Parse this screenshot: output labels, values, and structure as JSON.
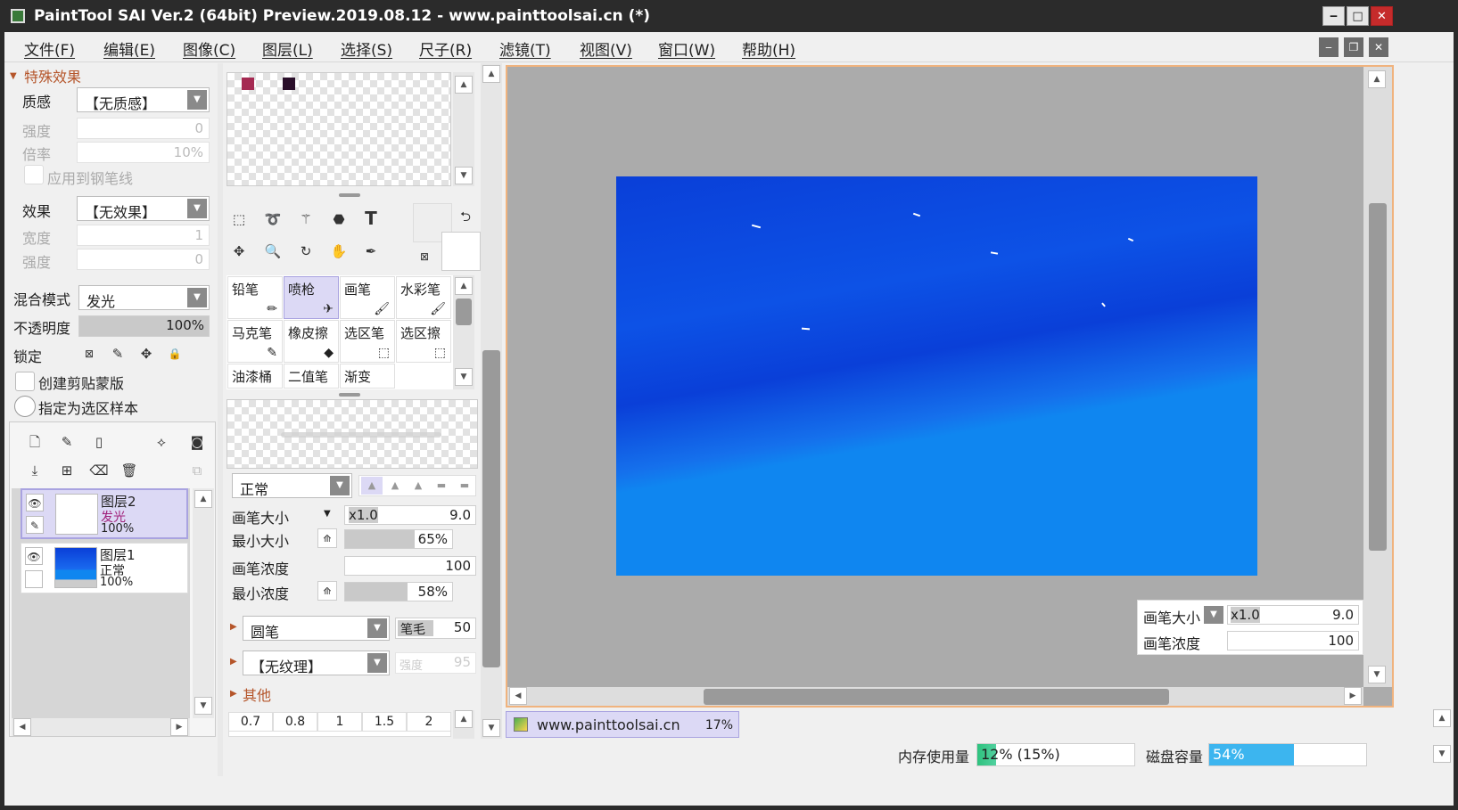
{
  "window": {
    "title": "PaintTool SAI Ver.2 (64bit) Preview.2019.08.12 - www.painttoolsai.cn (*)"
  },
  "menu": [
    "文件(F)",
    "编辑(E)",
    "图像(C)",
    "图层(L)",
    "选择(S)",
    "尺子(R)",
    "滤镜(T)",
    "视图(V)",
    "窗口(W)",
    "帮助(H)"
  ],
  "effects": {
    "header": "特殊效果",
    "texture_label": "质感",
    "texture_value": "【无质感】",
    "strength_label": "强度",
    "strength_value": "0",
    "scale_label": "倍率",
    "scale_value": "10%",
    "apply_pen_label": "应用到钢笔线",
    "effect_label": "效果",
    "effect_value": "【无效果】",
    "width_label": "宽度",
    "width_value": "1",
    "strength2_label": "强度",
    "strength2_value": "0"
  },
  "layer_props": {
    "blend_label": "混合模式",
    "blend_value": "发光",
    "opacity_label": "不透明度",
    "opacity_value": "100%",
    "opacity_fraction": 1.0,
    "lock_label": "锁定",
    "clip_label": "创建剪贴蒙版",
    "sample_label": "指定为选区样本"
  },
  "layers": [
    {
      "name": "图层2",
      "mode": "发光",
      "opacity": "100%"
    },
    {
      "name": "图层1",
      "mode": "正常",
      "opacity": "100%"
    }
  ],
  "tools_grid": [
    [
      "铅笔",
      "喷枪",
      "画笔",
      "水彩笔"
    ],
    [
      "马克笔",
      "橡皮擦",
      "选区笔",
      "选区擦"
    ],
    [
      "油漆桶",
      "二值笔",
      "渐变",
      ""
    ]
  ],
  "brush": {
    "mode_value": "正常",
    "size_label": "画笔大小",
    "size_mult": "x1.0",
    "size_value": "9.0",
    "min_size_label": "最小大小",
    "min_size_value": "65%",
    "min_size_fraction": 0.65,
    "density_label": "画笔浓度",
    "density_value": "100",
    "min_density_label": "最小浓度",
    "min_density_value": "58%",
    "min_density_fraction": 0.58,
    "shape_value": "圆笔",
    "bristle_label": "笔毛",
    "bristle_value": "50",
    "texture_value": "【无纹理】",
    "texture_strength_label": "强度",
    "texture_strength_value": "95",
    "other_label": "其他",
    "size_presets": [
      "0.7",
      "0.8",
      "1",
      "1.5",
      "2"
    ]
  },
  "canvas_overlay": {
    "size_label": "画笔大小",
    "size_mult": "x1.0",
    "size_value": "9.0",
    "density_label": "画笔浓度",
    "density_value": "100"
  },
  "doc_tab": {
    "name": "www.painttoolsai.cn",
    "zoom": "17%"
  },
  "status": {
    "memory_label": "内存使用量",
    "memory_value": "12% (15%)",
    "memory_fraction": 0.12,
    "disk_label": "磁盘容量",
    "disk_value": "54%",
    "disk_fraction": 0.54
  },
  "colors": {
    "swatch1": "#a52a52",
    "swatch2": "#2a0f2a",
    "accent": "#dcd9f5",
    "canvas_light": "#0f86f0",
    "canvas_dark": "#0a3fd8"
  }
}
